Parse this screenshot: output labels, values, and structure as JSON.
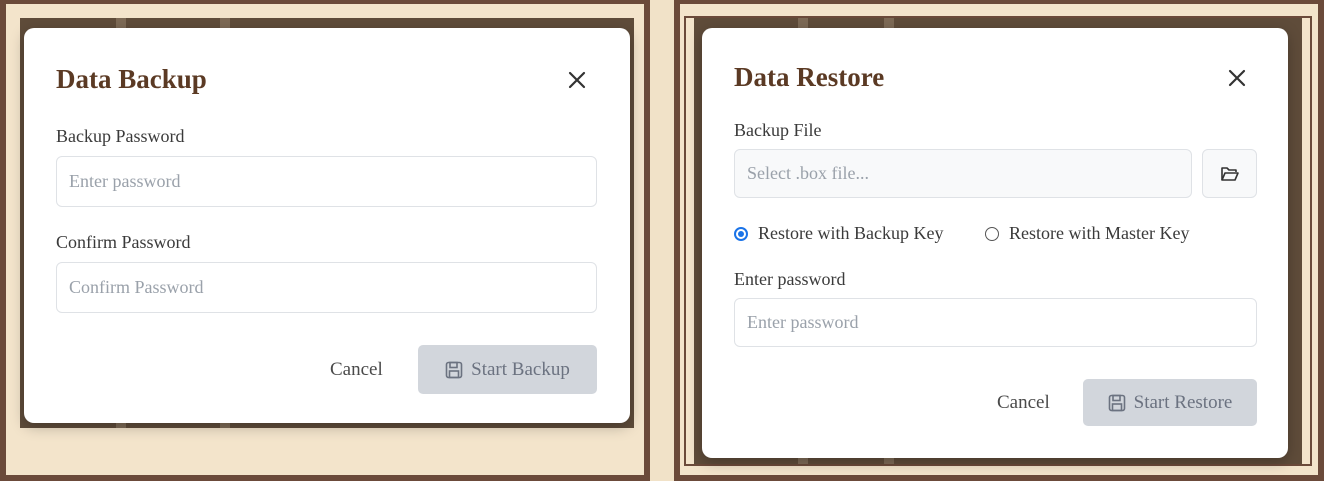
{
  "backup_dialog": {
    "title": "Data Backup",
    "password_label": "Backup Password",
    "password_placeholder": "Enter password",
    "confirm_label": "Confirm Password",
    "confirm_placeholder": "Confirm Password",
    "cancel_label": "Cancel",
    "start_label": "Start Backup",
    "close_icon": "close-icon",
    "start_icon": "save-icon"
  },
  "restore_dialog": {
    "title": "Data Restore",
    "file_label": "Backup File",
    "file_placeholder": "Select .box file...",
    "browse_icon": "folder-open-icon",
    "radio_options": [
      {
        "label": "Restore with Backup Key",
        "checked": true
      },
      {
        "label": "Restore with Master Key",
        "checked": false
      }
    ],
    "password_label": "Enter password",
    "password_placeholder": "Enter password",
    "cancel_label": "Cancel",
    "start_label": "Start Restore",
    "close_icon": "close-icon",
    "start_icon": "save-icon"
  },
  "colors": {
    "frame": "#6b4a3a",
    "background": "#f1e2c8",
    "title": "#5b3a24",
    "radio_accent": "#1a73e8",
    "disabled_button": "#d2d6dc"
  }
}
